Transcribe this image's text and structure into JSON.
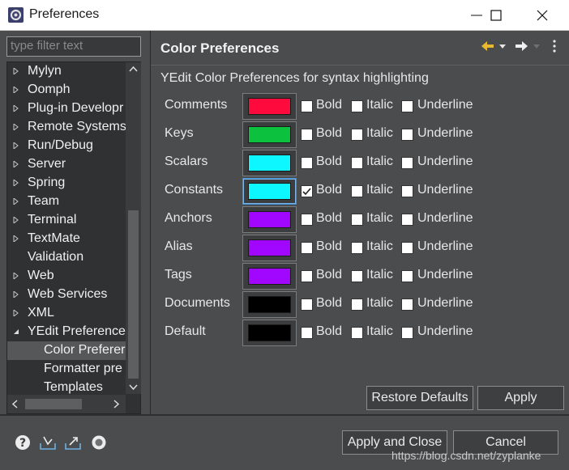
{
  "window": {
    "title": "Preferences"
  },
  "filter": {
    "placeholder": "type filter text"
  },
  "tree": {
    "items": [
      {
        "label": "Mylyn",
        "expandable": true
      },
      {
        "label": "Oomph",
        "expandable": true
      },
      {
        "label": "Plug-in Developr",
        "expandable": true
      },
      {
        "label": "Remote Systems",
        "expandable": true
      },
      {
        "label": "Run/Debug",
        "expandable": true
      },
      {
        "label": "Server",
        "expandable": true
      },
      {
        "label": "Spring",
        "expandable": true
      },
      {
        "label": "Team",
        "expandable": true
      },
      {
        "label": "Terminal",
        "expandable": true
      },
      {
        "label": "TextMate",
        "expandable": true
      },
      {
        "label": "Validation",
        "expandable": false
      },
      {
        "label": "Web",
        "expandable": true
      },
      {
        "label": "Web Services",
        "expandable": true
      },
      {
        "label": "XML",
        "expandable": true
      },
      {
        "label": "YEdit Preference",
        "expanded": true
      },
      {
        "label": "Color Preferer",
        "child": true,
        "selected": true
      },
      {
        "label": "Formatter pre",
        "child": true
      },
      {
        "label": "Templates",
        "child": true
      }
    ]
  },
  "panel": {
    "title": "Color Preferences",
    "subtitle": "YEdit Color Preferences for syntax highlighting"
  },
  "checkbox_labels": {
    "bold": "Bold",
    "italic": "Italic",
    "underline": "Underline"
  },
  "color_rows": [
    {
      "label": "Comments",
      "color": "#ff0a3c",
      "bold": false,
      "italic": false,
      "underline": false
    },
    {
      "label": "Keys",
      "color": "#0bc13e",
      "bold": false,
      "italic": false,
      "underline": false
    },
    {
      "label": "Scalars",
      "color": "#0cf7ff",
      "bold": false,
      "italic": false,
      "underline": false
    },
    {
      "label": "Constants",
      "color": "#0cf7ff",
      "bold": true,
      "italic": false,
      "underline": false,
      "focused": true
    },
    {
      "label": "Anchors",
      "color": "#a107ff",
      "bold": false,
      "italic": false,
      "underline": false
    },
    {
      "label": "Alias",
      "color": "#a107ff",
      "bold": false,
      "italic": false,
      "underline": false
    },
    {
      "label": "Tags",
      "color": "#a107ff",
      "bold": false,
      "italic": false,
      "underline": false
    },
    {
      "label": "Documents",
      "color": "#000000",
      "bold": false,
      "italic": false,
      "underline": false
    },
    {
      "label": "Default",
      "color": "#000000",
      "bold": false,
      "italic": false,
      "underline": false
    }
  ],
  "buttons": {
    "restore_defaults": "Restore Defaults",
    "apply": "Apply",
    "apply_and_close": "Apply and Close",
    "cancel": "Cancel"
  },
  "watermark": "https://blog.csdn.net/zyplanke",
  "icons": {
    "back": "back-arrow-icon",
    "forward": "forward-arrow-icon",
    "menu": "view-menu-icon",
    "help": "help-icon",
    "import": "import-icon",
    "export": "export-icon",
    "oomph": "oomph-record-icon"
  }
}
